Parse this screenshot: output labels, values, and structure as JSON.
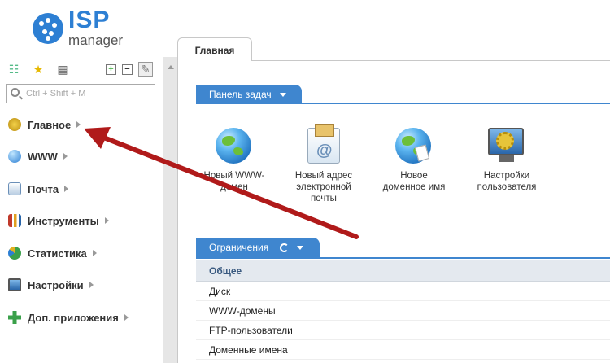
{
  "logo": {
    "brand": "ISP",
    "product": "manager"
  },
  "search": {
    "placeholder": "Ctrl + Shift + M"
  },
  "sidebar": {
    "items": [
      {
        "label": "Главное",
        "icon": "home-icon",
        "color": "#e0b020"
      },
      {
        "label": "WWW",
        "icon": "globe-icon",
        "color": "#3b8fd6"
      },
      {
        "label": "Почта",
        "icon": "mail-icon",
        "color": "#6a8fb8"
      },
      {
        "label": "Инструменты",
        "icon": "tools-icon",
        "color": "#c0392b"
      },
      {
        "label": "Статистика",
        "icon": "pie-chart-icon",
        "color": "#3aa04a"
      },
      {
        "label": "Настройки",
        "icon": "monitor-icon",
        "color": "#2a66aa"
      },
      {
        "label": "Доп. приложения",
        "icon": "plus-icon",
        "color": "#3aa04a"
      }
    ]
  },
  "tab": {
    "label": "Главная"
  },
  "tasks_panel": {
    "title": "Панель задач",
    "tasks": [
      {
        "label": "Новый WWW-\nдомен",
        "icon": "globe-icon"
      },
      {
        "label": "Новый адрес\nэлектронной\nпочты",
        "icon": "mail-icon"
      },
      {
        "label": "Новое\nдоменное имя",
        "icon": "globe-doc-icon"
      },
      {
        "label": "Настройки\nпользователя",
        "icon": "settings-monitor-icon"
      }
    ]
  },
  "limits_panel": {
    "title": "Ограничения",
    "header": "Общее",
    "rows": [
      "Диск",
      "WWW-домены",
      "FTP-пользователи",
      "Доменные имена"
    ]
  },
  "colors": {
    "accent": "#3f86cf",
    "annotation_arrow": "#b01a1a"
  }
}
